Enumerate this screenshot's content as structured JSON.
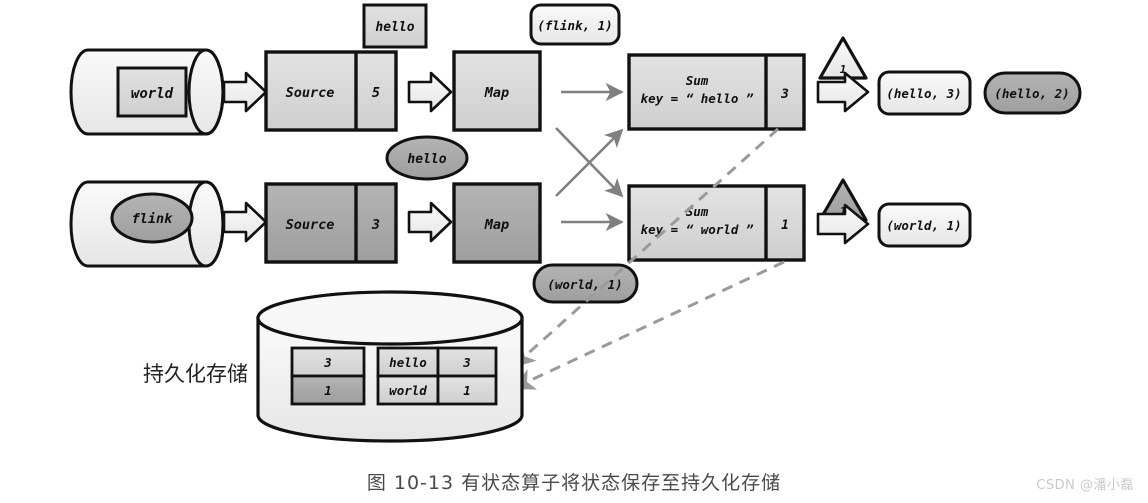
{
  "figure": {
    "caption": "图 10-13  有状态算子将状态保存至持久化存储",
    "watermark": "CSDN @潘小磊"
  },
  "rows": [
    {
      "id": "row-hello",
      "stream_record": "world",
      "source_label": "Source",
      "source_offset": "5",
      "map_label": "Map",
      "sum_title": "Sum",
      "sum_key": "key = “ hello ”",
      "sum_value": "3",
      "checkpoint_barrier": "1",
      "output_record": "(hello, 3)"
    },
    {
      "id": "row-world",
      "stream_record": "flink",
      "source_label": "Source",
      "source_offset": "3",
      "map_label": "Map",
      "sum_title": "Sum",
      "sum_key": "key = “ world ”",
      "sum_value": "1",
      "checkpoint_barrier": "1",
      "output_record": "(world, 1)"
    }
  ],
  "floating": {
    "hello_box": "hello",
    "flink_tuple": "(flink, 1)",
    "hello_ellipse": "hello",
    "world_tuple": "(world, 1)",
    "hello_two_pill": "(hello, 2)"
  },
  "storage": {
    "label": "持久化存储",
    "offset_table": {
      "rows": [
        {
          "value": "3",
          "shade": "light"
        },
        {
          "value": "1",
          "shade": "dark"
        }
      ]
    },
    "state_table": {
      "rows": [
        {
          "key": "hello",
          "value": "3"
        },
        {
          "key": "world",
          "value": "1"
        }
      ]
    }
  },
  "colors": {
    "outline": "#111111",
    "fill_light": "#f2f2f2",
    "fill_mid": "#d8d8d8",
    "fill_dark": "#a8a8a8",
    "arrow_gray": "#808080",
    "dashed_gray": "#9a9a9a",
    "text": "#101010"
  }
}
